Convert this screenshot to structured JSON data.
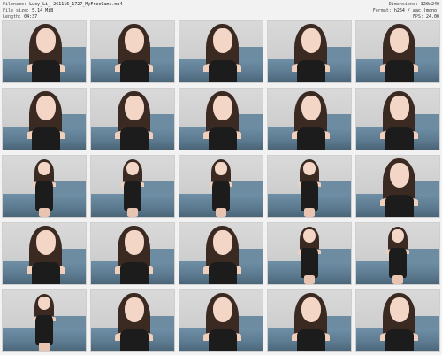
{
  "info": {
    "filename_label": "Filename:",
    "filename": "Lucy_Li_ 261116_1727_MyFreeCams.mp4",
    "filesize_label": "File size:",
    "filesize": "5.14 MiB",
    "length_label": "Length:",
    "length": "04:37",
    "dimensions_label": "Dimensions:",
    "dimensions": "320x240",
    "format_label": "Format:",
    "format": "h264 / aac (mono)",
    "fps_label": "FPS:",
    "fps": "24.00"
  },
  "thumbnails": [
    {
      "pose": "portrait"
    },
    {
      "pose": "portrait"
    },
    {
      "pose": "portrait"
    },
    {
      "pose": "portrait"
    },
    {
      "pose": "portrait"
    },
    {
      "pose": "portrait"
    },
    {
      "pose": "portrait"
    },
    {
      "pose": "portrait"
    },
    {
      "pose": "portrait"
    },
    {
      "pose": "portrait"
    },
    {
      "pose": "full"
    },
    {
      "pose": "full"
    },
    {
      "pose": "full"
    },
    {
      "pose": "full"
    },
    {
      "pose": "portrait"
    },
    {
      "pose": "portrait"
    },
    {
      "pose": "portrait"
    },
    {
      "pose": "portrait"
    },
    {
      "pose": "full"
    },
    {
      "pose": "full"
    },
    {
      "pose": "full"
    },
    {
      "pose": "portrait"
    },
    {
      "pose": "portrait"
    },
    {
      "pose": "portrait"
    },
    {
      "pose": "portrait"
    }
  ],
  "colors": {
    "background": "#f2f2f2",
    "hair": "#3b2a22",
    "couch": "#5c7a90",
    "outfit": "#1c1c1c"
  }
}
